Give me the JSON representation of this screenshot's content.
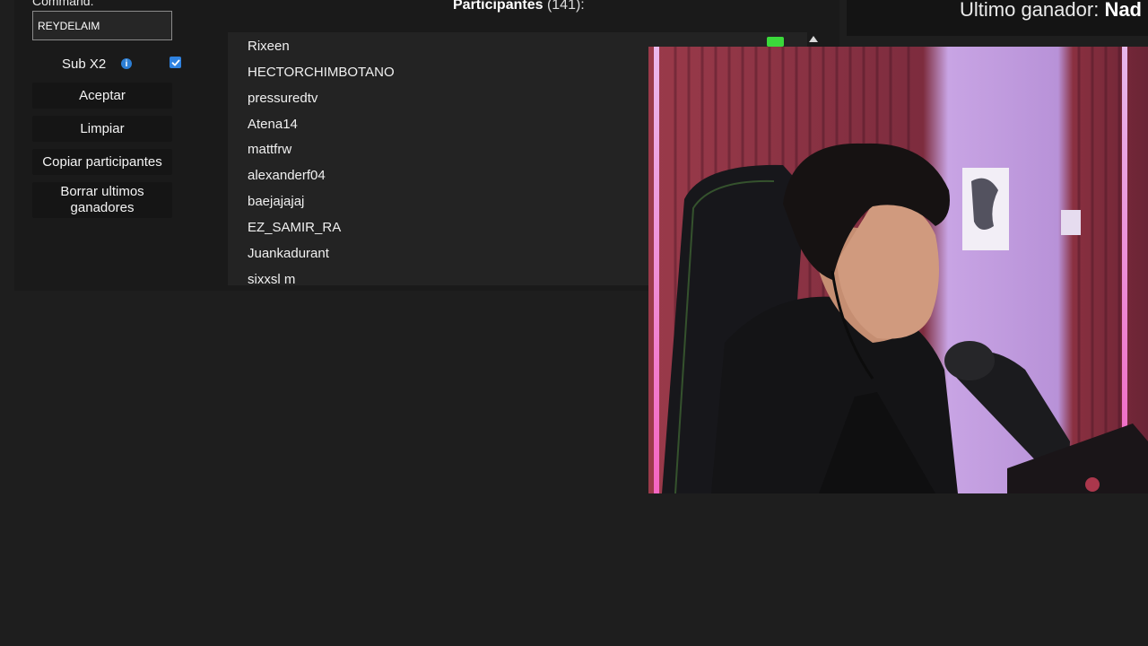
{
  "sidebar": {
    "command_label": "Command:",
    "command_value": "REYDELAIM",
    "sub_label": "Sub X2",
    "sub_checked": true,
    "buttons": {
      "aceptar": "Aceptar",
      "limpiar": "Limpiar",
      "copiar": "Copiar participantes",
      "borrar": "Borrar ultimos ganadores"
    }
  },
  "participants": {
    "title": "Participantes",
    "count": "(141):",
    "items": [
      "Rixeen",
      "HECTORCHIMBOTANO",
      "pressuredtv",
      "Atena14",
      "mattfrw",
      "alexanderf04",
      "baejajajaj",
      "EZ_SAMIR_RA",
      "Juankadurant",
      "sixxsl m"
    ]
  },
  "header": {
    "ultimo_label": "Ultimo ganador:",
    "ultimo_name": "Nad"
  },
  "colors": {
    "accent": "#2f82e0",
    "badge": "#3bd93b"
  }
}
